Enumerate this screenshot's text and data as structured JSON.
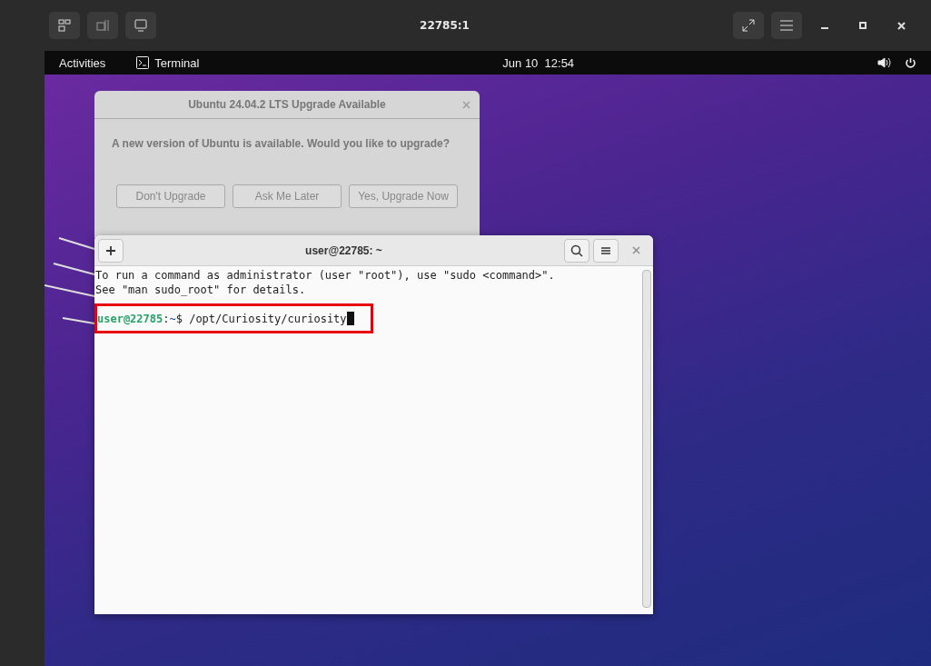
{
  "viewer": {
    "title": "22785:1"
  },
  "top_bar": {
    "activities": "Activities",
    "app": "Terminal",
    "clock": "Jun 10  12:54"
  },
  "dialog": {
    "title": "Ubuntu 24.04.2 LTS Upgrade Available",
    "message": "A new version of Ubuntu is available. Would you like to upgrade?",
    "buttons": [
      "Don't Upgrade",
      "Ask Me Later",
      "Yes, Upgrade Now"
    ]
  },
  "terminal": {
    "title": "user@22785: ~",
    "lines": [
      "To run a command as administrator (user \"root\"), use \"sudo <command>\".",
      "See \"man sudo_root\" for details."
    ],
    "prompt": {
      "user": "user@22785",
      "separator": ":",
      "path": "~",
      "command": "$ /opt/Curiosity/curiosity"
    }
  }
}
